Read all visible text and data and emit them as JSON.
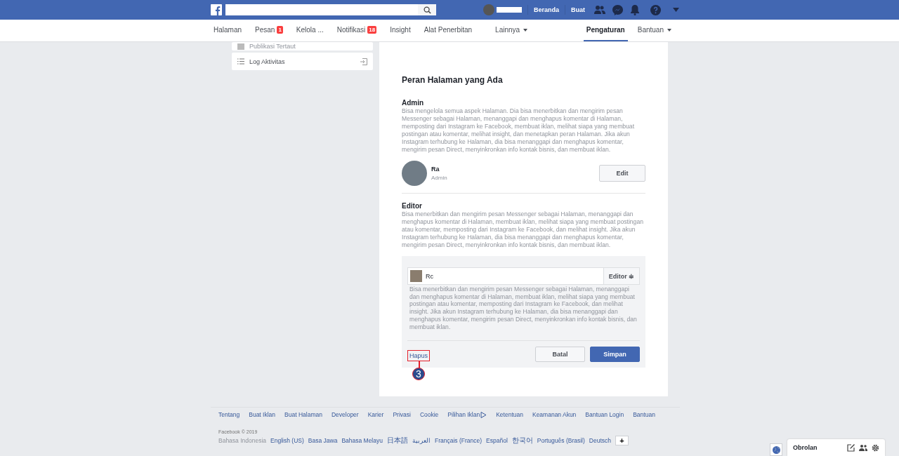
{
  "top_bar": {
    "links": [
      "Beranda",
      "Buat"
    ]
  },
  "nav": {
    "items": [
      {
        "label": "Halaman",
        "dropdown": false,
        "selected": false
      },
      {
        "label": "Pesan",
        "badge": "1",
        "dropdown": false,
        "selected": false
      },
      {
        "label": "Kelola ...",
        "dropdown": false,
        "selected": false
      },
      {
        "label": "Notifikasi",
        "badge": "18",
        "dropdown": false,
        "selected": false
      },
      {
        "label": "Insight",
        "dropdown": false,
        "selected": false
      },
      {
        "label": "Alat Penerbitan",
        "dropdown": false,
        "selected": false
      },
      {
        "label": "Lainnya",
        "dropdown": true,
        "selected": false
      }
    ],
    "right_items": [
      {
        "label": "Pengaturan",
        "dropdown": false,
        "selected": true
      },
      {
        "label": "Bantuan",
        "dropdown": true,
        "selected": false
      }
    ]
  },
  "sidebar": {
    "items": [
      "Publikasi Tertaut",
      "Log Aktivitas"
    ]
  },
  "panel": {
    "title": "Peran Halaman yang Ada",
    "sections": [
      {
        "heading": "Admin",
        "description": "Bisa mengelola semua aspek Halaman. Dia bisa menerbitkan dan mengirim pesan Messenger sebagai Halaman, menanggapi dan menghapus komentar di Halaman, memposting dari Instagram ke Facebook, membuat iklan, melihat siapa yang membuat postingan atau komentar, melihat insight, dan menetapkan peran Halaman. Jika akun Instagram terhubung ke Halaman, dia bisa menanggapi dan menghapus komentar, mengirim pesan Direct, menyinkronkan info kontak bisnis, dan membuat iklan.",
        "person": {
          "name": "Ra",
          "role": "Admin"
        },
        "button": "Edit"
      },
      {
        "heading": "Editor",
        "description": "Bisa menerbitkan dan mengirim pesan Messenger sebagai Halaman, menanggapi dan menghapus komentar di Halaman, membuat iklan, melihat siapa yang membuat postingan atau komentar, memposting dari Instagram ke Facebook, dan melihat insight. Jika akun Instagram terhubung ke Halaman, dia bisa menanggapi dan menghapus komentar, mengirim pesan Direct, menyinkronkan info kontak bisnis, dan membuat iklan."
      }
    ],
    "edit_box": {
      "name_value": "Rc",
      "role_select": "Editor ≑",
      "description": "Bisa menerbitkan dan mengirim pesan Messenger sebagai Halaman, menanggapi dan menghapus komentar di Halaman, membuat iklan, melihat siapa yang membuat postingan atau komentar, memposting dari Instagram ke Facebook, dan melihat insight. Jika akun Instagram terhubung ke Halaman, dia bisa menanggapi dan menghapus komentar, mengirim pesan Direct, menyinkronkan info kontak bisnis, dan membuat iklan.",
      "remove_link": "Hapus",
      "cancel_button": "Batal",
      "save_button": "Simpan"
    },
    "annotation": {
      "marker": "3"
    }
  },
  "footer": {
    "links": [
      "Tentang",
      "Buat Iklan",
      "Buat Halaman",
      "Developer",
      "Karier",
      "Privasi",
      "Cookie",
      "Pilihan Iklan",
      "Ketentuan",
      "Keamanan Akun",
      "Bantuan Login",
      "Bantuan"
    ],
    "copyright": "Facebook © 2019",
    "languages": [
      {
        "label": "Bahasa Indonesia",
        "selected": true
      },
      {
        "label": "English (US)",
        "selected": false
      },
      {
        "label": "Basa Jawa",
        "selected": false
      },
      {
        "label": "Bahasa Melayu",
        "selected": false
      },
      {
        "label": "日本語",
        "selected": false
      },
      {
        "label": "العربية",
        "selected": false
      },
      {
        "label": "Français (France)",
        "selected": false
      },
      {
        "label": "Español",
        "selected": false
      },
      {
        "label": "한국어",
        "selected": false
      },
      {
        "label": "Português (Brasil)",
        "selected": false
      },
      {
        "label": "Deutsch",
        "selected": false
      }
    ],
    "more_button": "+"
  },
  "chat": {
    "title": "Obrolan"
  }
}
